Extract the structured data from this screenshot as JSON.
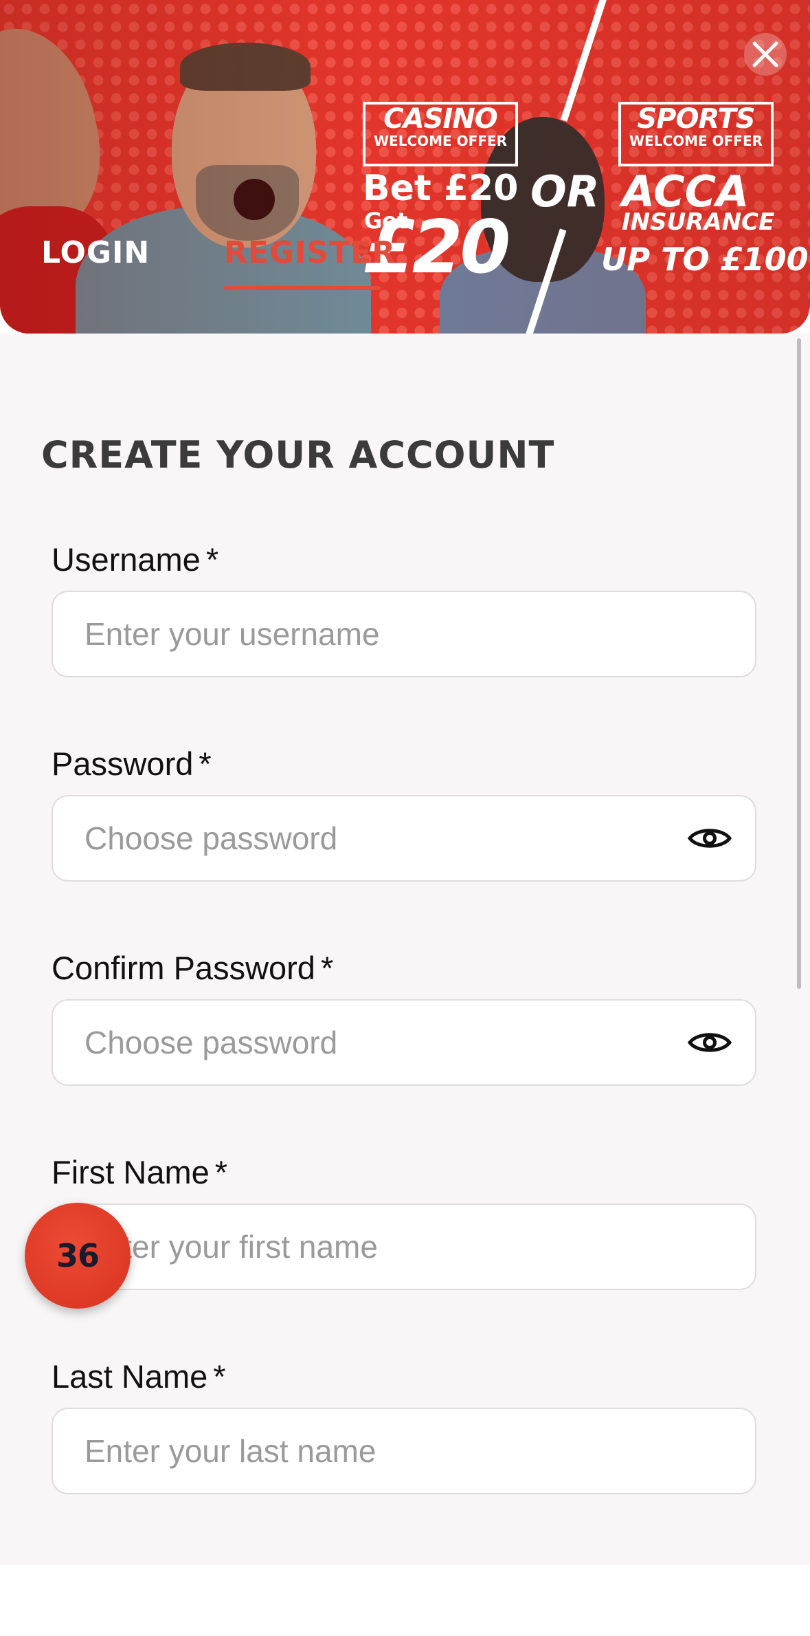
{
  "banner": {
    "casino_title": "CASINO",
    "casino_subtitle": "WELCOME OFFER",
    "sports_title": "SPORTS",
    "sports_subtitle": "WELCOME OFFER",
    "bet_text": "Bet £20",
    "or_text": "OR",
    "acca_text": "ACCA",
    "get_text": "Get",
    "amount_text": "£20",
    "insurance_text": "INSURANCE",
    "upto_text": "UP TO £100",
    "accent_color": "#e2352b"
  },
  "tabs": {
    "login_label": "LOGIN",
    "register_label": "REGISTER",
    "active": "REGISTER"
  },
  "form": {
    "title": "CREATE YOUR ACCOUNT",
    "required_marker": "*",
    "username": {
      "label": "Username",
      "placeholder": "Enter your username",
      "value": ""
    },
    "password": {
      "label": "Password",
      "placeholder": "Choose password",
      "value": ""
    },
    "confirm_password": {
      "label": "Confirm Password",
      "placeholder": "Choose password",
      "value": ""
    },
    "first_name": {
      "label": "First Name",
      "placeholder": "Enter your first name",
      "value": ""
    },
    "last_name": {
      "label": "Last Name",
      "placeholder": "Enter your last name",
      "value": ""
    }
  },
  "badge": {
    "text": "36"
  },
  "icons": {
    "close": "close-icon",
    "password_toggle": "eye-icon"
  }
}
